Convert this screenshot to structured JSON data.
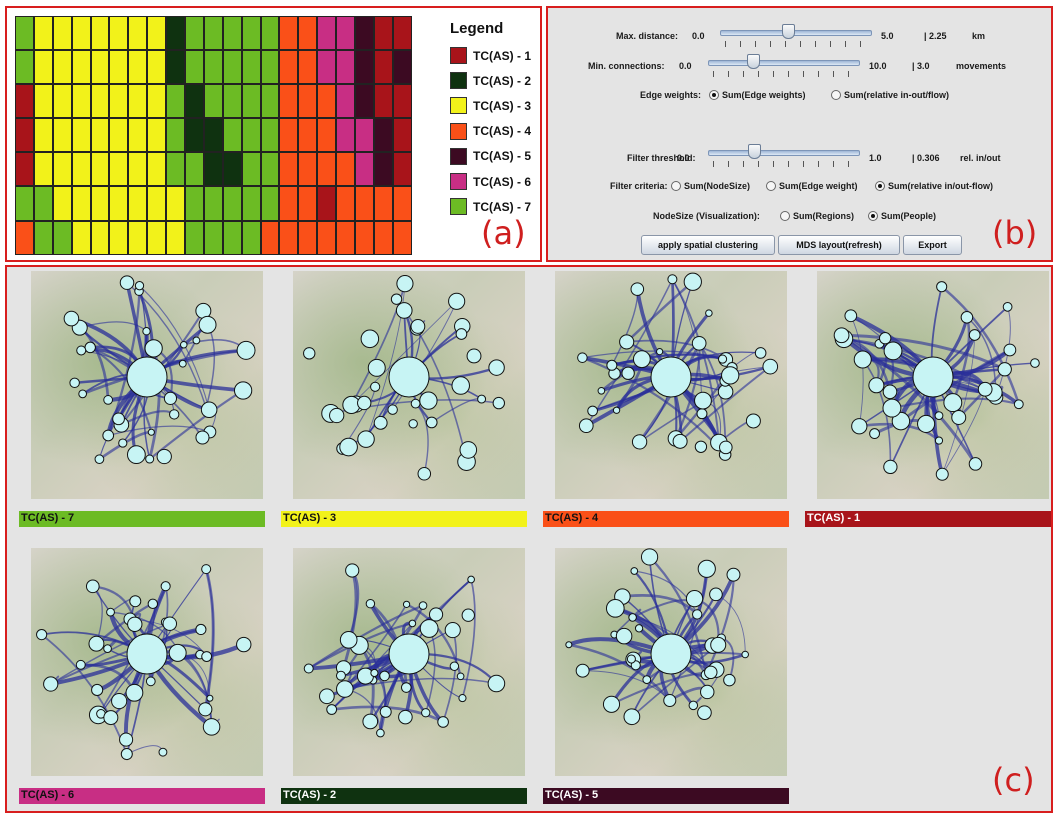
{
  "legend": {
    "title": "Legend",
    "items": [
      {
        "label": "TC(AS) - 1",
        "color": "#a8141a"
      },
      {
        "label": "TC(AS) - 2",
        "color": "#0f3210"
      },
      {
        "label": "TC(AS) - 3",
        "color": "#f2f21a"
      },
      {
        "label": "TC(AS) - 4",
        "color": "#fa5018"
      },
      {
        "label": "TC(AS) - 5",
        "color": "#3c0a22"
      },
      {
        "label": "TC(AS) - 6",
        "color": "#c82e84"
      },
      {
        "label": "TC(AS) - 7",
        "color": "#6cbb24"
      }
    ]
  },
  "grid_rows": [
    [
      7,
      3,
      3,
      3,
      3,
      3,
      3,
      3,
      2,
      7,
      7,
      7,
      7,
      7,
      4,
      4,
      6,
      6,
      5,
      1,
      1
    ],
    [
      7,
      3,
      3,
      3,
      3,
      3,
      3,
      3,
      2,
      7,
      7,
      7,
      7,
      7,
      4,
      4,
      6,
      6,
      5,
      1,
      5
    ],
    [
      1,
      3,
      3,
      3,
      3,
      3,
      3,
      3,
      7,
      2,
      7,
      7,
      7,
      7,
      4,
      4,
      4,
      6,
      5,
      1,
      1
    ],
    [
      1,
      3,
      3,
      3,
      3,
      3,
      3,
      3,
      7,
      2,
      2,
      7,
      7,
      7,
      4,
      4,
      4,
      6,
      6,
      5,
      1
    ],
    [
      1,
      3,
      3,
      3,
      3,
      3,
      3,
      3,
      7,
      7,
      2,
      2,
      7,
      7,
      4,
      4,
      4,
      4,
      6,
      5,
      1
    ],
    [
      7,
      7,
      3,
      3,
      3,
      3,
      3,
      3,
      3,
      7,
      7,
      7,
      7,
      7,
      4,
      4,
      1,
      4,
      4,
      4,
      4
    ],
    [
      4,
      7,
      7,
      3,
      3,
      3,
      3,
      3,
      3,
      7,
      7,
      7,
      7,
      4,
      4,
      4,
      4,
      4,
      4,
      4,
      4
    ]
  ],
  "panel_labels": {
    "a": "(a)",
    "b": "(b)",
    "c": "(c)"
  },
  "controls": {
    "max_distance": {
      "label": "Max. distance:",
      "min": "0.0",
      "max": "5.0",
      "value": "| 2.25",
      "unit": "km",
      "fraction": 0.45
    },
    "min_connections": {
      "label": "Min. connections:",
      "min": "0.0",
      "max": "10.0",
      "value": "| 3.0",
      "unit": "movements",
      "fraction": 0.3
    },
    "edge_weights": {
      "label": "Edge weights:",
      "options": [
        "Sum(Edge weights)",
        "Sum(relative in-out/flow)"
      ],
      "selected": 0
    },
    "filter_threshold": {
      "label": "Filter threshold:",
      "min": "0.0",
      "max": "1.0",
      "value": "| 0.306",
      "unit": "rel. in/out",
      "fraction": 0.306
    },
    "filter_criteria": {
      "label": "Filter criteria:",
      "options": [
        "Sum(NodeSize)",
        "Sum(Edge weight)",
        "Sum(relative in/out-flow)"
      ],
      "selected": 2
    },
    "node_size": {
      "label": "NodeSize (Visualization):",
      "options": [
        "Sum(Regions)",
        "Sum(People)"
      ],
      "selected": 1
    },
    "buttons": {
      "apply": "apply spatial clustering",
      "mds": "MDS layout(refresh)",
      "export": "Export"
    }
  },
  "maps": [
    {
      "label": "TC(AS) - 7",
      "color": "#6cbb24",
      "text_color": "#111111"
    },
    {
      "label": "TC(AS) - 3",
      "color": "#f2f21a",
      "text_color": "#111111"
    },
    {
      "label": "TC(AS) - 4",
      "color": "#fa5018",
      "text_color": "#111111"
    },
    {
      "label": "TC(AS) - 1",
      "color": "#a8141a",
      "text_color": "#ffffff"
    },
    {
      "label": "TC(AS) - 6",
      "color": "#c82e84",
      "text_color": "#111111"
    },
    {
      "label": "TC(AS) - 2",
      "color": "#0f3210",
      "text_color": "#ffffff"
    },
    {
      "label": "TC(AS) - 5",
      "color": "#3c0a22",
      "text_color": "#ffffff"
    }
  ]
}
